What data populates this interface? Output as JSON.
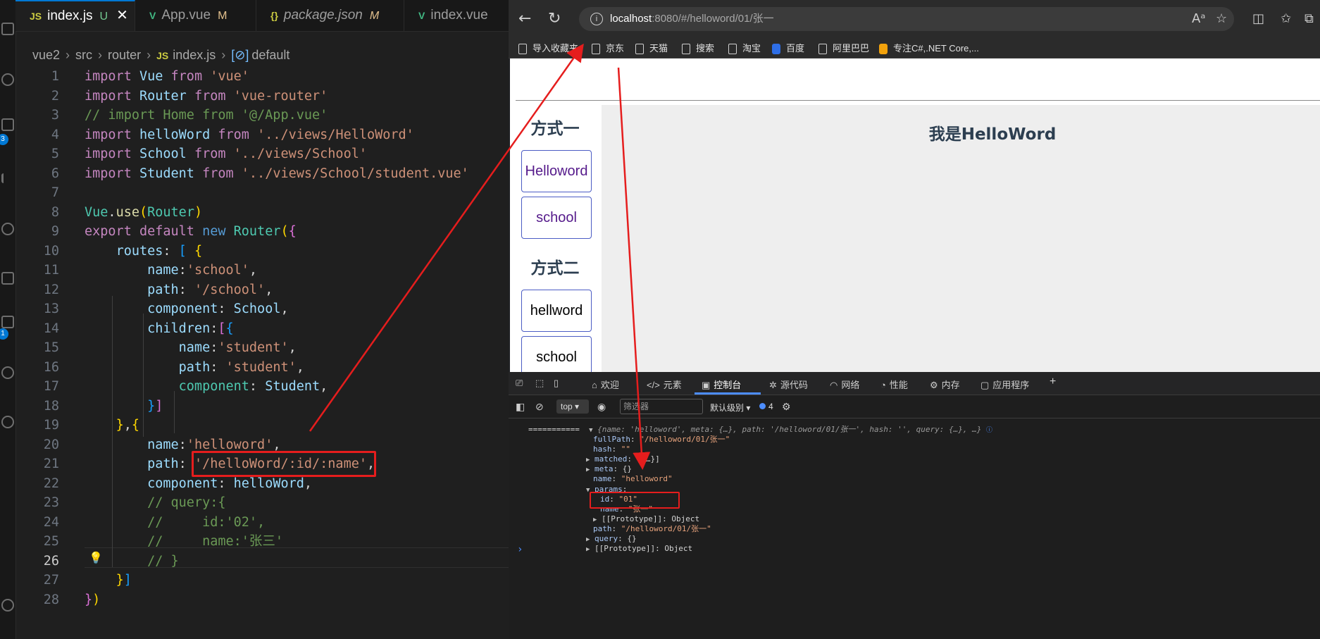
{
  "editor": {
    "tabs": [
      {
        "label": "index.js",
        "icon": "JS",
        "status": "U",
        "active": true,
        "close": "✕"
      },
      {
        "label": "App.vue",
        "icon": "V",
        "status": "M"
      },
      {
        "label": "package.json",
        "icon": "{}",
        "status": "M"
      },
      {
        "label": "index.vue",
        "icon": "V",
        "status": ""
      }
    ],
    "breadcrumb": {
      "parts": [
        "vue2",
        "src",
        "router"
      ],
      "file": "index.js",
      "file_icon": "JS",
      "symbol": "default",
      "symbol_icon": "[⊘]"
    },
    "line_numbers": [
      "1",
      "2",
      "3",
      "4",
      "5",
      "6",
      "7",
      "8",
      "9",
      "10",
      "11",
      "12",
      "13",
      "14",
      "15",
      "16",
      "17",
      "18",
      "19",
      "20",
      "21",
      "22",
      "23",
      "24",
      "25",
      "26",
      "27",
      "28"
    ],
    "current_line": "26",
    "code": {
      "l1": [
        "import",
        "Vue",
        "from",
        "'vue'"
      ],
      "l2": [
        "import",
        "Router",
        "from",
        "'vue-router'"
      ],
      "l3": "// import Home from '@/App.vue'",
      "l4": [
        "import",
        "helloWord",
        "from",
        "'../views/HelloWord'"
      ],
      "l5": [
        "import",
        "School",
        "from",
        "'../views/School'"
      ],
      "l6": [
        "import",
        "Student",
        "from",
        "'../views/School/student.vue'"
      ],
      "l8": [
        "Vue",
        ".",
        "use",
        "(",
        "Router",
        ")"
      ],
      "l9": [
        "export",
        "default",
        "new",
        "Router",
        "(",
        "{"
      ],
      "l10": [
        "routes",
        ": ",
        "[",
        "{"
      ],
      "l11": [
        "name",
        ":",
        "'school'",
        ","
      ],
      "l12": [
        "path",
        ": ",
        "'/school'",
        ","
      ],
      "l13": [
        "component",
        ": ",
        "School",
        ","
      ],
      "l14": [
        "children",
        ":",
        "[",
        "{"
      ],
      "l15": [
        "name",
        ":",
        "'student'",
        ","
      ],
      "l16": [
        "path",
        ": ",
        "'student'",
        ","
      ],
      "l17": [
        "component",
        ": ",
        "Student",
        ","
      ],
      "l18": [
        "}",
        "]"
      ],
      "l19": [
        "}",
        ",",
        "{"
      ],
      "l20": [
        "name",
        ":",
        "'helloword'",
        ","
      ],
      "l21": [
        "path",
        ": ",
        "'/helloWord/:id/:name'",
        ","
      ],
      "l22": [
        "component",
        ": ",
        "helloWord",
        ","
      ],
      "l23": "// query:{",
      "l24": "//     id:'02',",
      "l25": "//     name:'张三'",
      "l26": "// }",
      "l27": [
        "}",
        "]"
      ],
      "l28": [
        "}",
        ")"
      ]
    },
    "colors": {
      "highlight_box": "#e51d1d",
      "accent": "#0078d4"
    },
    "badges": [
      "3",
      "1"
    ]
  },
  "browser": {
    "url_host": "localhost",
    "url_rest": ":8080/#/helloword/01/张一",
    "favorites": [
      "导入收藏夹",
      "京东",
      "天猫",
      "搜索",
      "淘宝",
      "百度",
      "阿里巴巴",
      "专注C#,.NET Core,..."
    ],
    "page": {
      "section1": "方式一",
      "link1": "Helloword",
      "link2": "school",
      "section2": "方式二",
      "link3": "hellword",
      "link4": "school",
      "heading": "我是HelloWord"
    },
    "devtools": {
      "tabs": [
        "欢迎",
        "元素",
        "控制台",
        "源代码",
        "网络",
        "性能",
        "内存",
        "应用程序"
      ],
      "add_tab": "+",
      "active_tab": "控制台",
      "context": "top",
      "filter_placeholder": "筛选器",
      "level": "默认级别",
      "issues": "4",
      "console": {
        "prefix": "===========",
        "summary": "{name: 'helloword', meta: {…}, path: '/helloword/01/张一', hash: '', query: {…}, …}",
        "fullPath_key": "fullPath",
        "fullPath_val": "\"/helloword/01/张一\"",
        "hash_key": "hash",
        "hash_val": "\"\"",
        "matched_key": "matched",
        "matched_val": "[{…}]",
        "meta_key": "meta",
        "meta_val": "{}",
        "name_key": "name",
        "name_val": "\"helloword\"",
        "params_key": "params",
        "id_key": "id",
        "id_val": "\"01\"",
        "pname_key": "name",
        "pname_val": "\"张一\"",
        "proto1": "[[Prototype]]: Object",
        "path_key": "path",
        "path_val": "\"/helloword/01/张一\"",
        "query_key": "query",
        "query_val": "{}",
        "proto2": "[[Prototype]]: Object",
        "prompt": "›"
      }
    }
  }
}
